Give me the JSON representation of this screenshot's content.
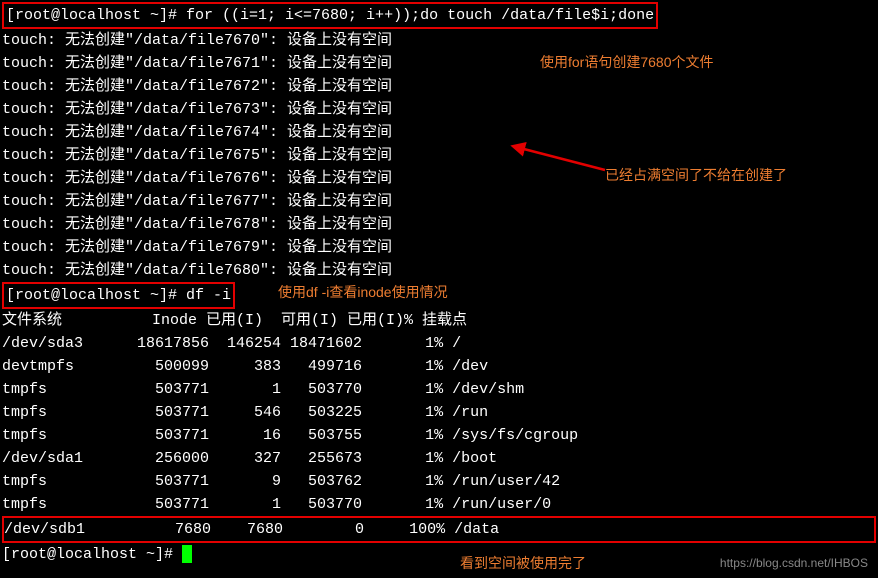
{
  "prompt": {
    "user": "[root@localhost ~]# ",
    "cmd1": "for ((i=1; i<=7680; i++));do touch /data/file$i;done",
    "cmd2": "df -i",
    "cmd3": ""
  },
  "touch_errors": [
    {
      "prefix": "touch: 无法创建",
      "path": "\"/data/file7670\"",
      "suffix": ": 设备上没有空间"
    },
    {
      "prefix": "touch: 无法创建",
      "path": "\"/data/file7671\"",
      "suffix": ": 设备上没有空间"
    },
    {
      "prefix": "touch: 无法创建",
      "path": "\"/data/file7672\"",
      "suffix": ": 设备上没有空间"
    },
    {
      "prefix": "touch: 无法创建",
      "path": "\"/data/file7673\"",
      "suffix": ": 设备上没有空间"
    },
    {
      "prefix": "touch: 无法创建",
      "path": "\"/data/file7674\"",
      "suffix": ": 设备上没有空间"
    },
    {
      "prefix": "touch: 无法创建",
      "path": "\"/data/file7675\"",
      "suffix": ": 设备上没有空间"
    },
    {
      "prefix": "touch: 无法创建",
      "path": "\"/data/file7676\"",
      "suffix": ": 设备上没有空间"
    },
    {
      "prefix": "touch: 无法创建",
      "path": "\"/data/file7677\"",
      "suffix": ": 设备上没有空间"
    },
    {
      "prefix": "touch: 无法创建",
      "path": "\"/data/file7678\"",
      "suffix": ": 设备上没有空间"
    },
    {
      "prefix": "touch: 无法创建",
      "path": "\"/data/file7679\"",
      "suffix": ": 设备上没有空间"
    },
    {
      "prefix": "touch: 无法创建",
      "path": "\"/data/file7680\"",
      "suffix": ": 设备上没有空间"
    }
  ],
  "df_header": "文件系统          Inode 已用(I)  可用(I) 已用(I)% 挂载点",
  "df_rows": [
    "/dev/sda3      18617856  146254 18471602       1% /",
    "devtmpfs         500099     383   499716       1% /dev",
    "tmpfs            503771       1   503770       1% /dev/shm",
    "tmpfs            503771     546   503225       1% /run",
    "tmpfs            503771      16   503755       1% /sys/fs/cgroup",
    "/dev/sda1        256000     327   255673       1% /boot",
    "tmpfs            503771       9   503762       1% /run/user/42",
    "tmpfs            503771       1   503770       1% /run/user/0"
  ],
  "df_last": "/dev/sdb1          7680    7680        0     100% /data",
  "annotations": {
    "a1": "使用for语句创建7680个文件",
    "a2": "已经占满空间了不给在创建了",
    "a3": "使用df -i查看inode使用情况",
    "a4": "看到空间被使用完了"
  },
  "watermark": "https://blog.csdn.net/IHBOS",
  "chart_data": {
    "type": "table",
    "title": "df -i output",
    "columns": [
      "文件系统",
      "Inode",
      "已用(I)",
      "可用(I)",
      "已用(I)%",
      "挂载点"
    ],
    "rows": [
      [
        "/dev/sda3",
        18617856,
        146254,
        18471602,
        "1%",
        "/"
      ],
      [
        "devtmpfs",
        500099,
        383,
        499716,
        "1%",
        "/dev"
      ],
      [
        "tmpfs",
        503771,
        1,
        503770,
        "1%",
        "/dev/shm"
      ],
      [
        "tmpfs",
        503771,
        546,
        503225,
        "1%",
        "/run"
      ],
      [
        "tmpfs",
        503771,
        16,
        503755,
        "1%",
        "/sys/fs/cgroup"
      ],
      [
        "/dev/sda1",
        256000,
        327,
        255673,
        "1%",
        "/boot"
      ],
      [
        "tmpfs",
        503771,
        9,
        503762,
        "1%",
        "/run/user/42"
      ],
      [
        "tmpfs",
        503771,
        1,
        503770,
        "1%",
        "/run/user/0"
      ],
      [
        "/dev/sdb1",
        7680,
        7680,
        0,
        "100%",
        "/data"
      ]
    ]
  }
}
